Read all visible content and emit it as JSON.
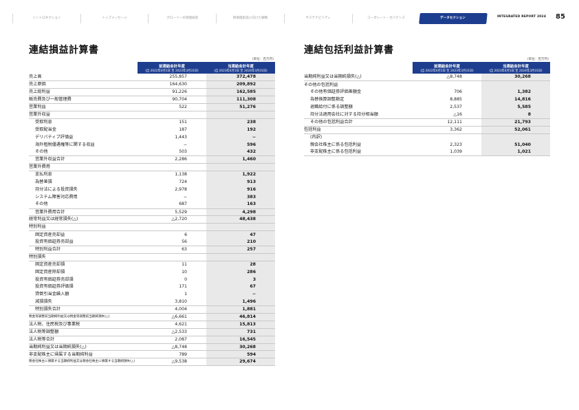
{
  "nav": {
    "items": [
      {
        "label": "イントロダクション",
        "active": false
      },
      {
        "label": "トップメッセージ",
        "active": false
      },
      {
        "label": "グローリーの価値創造",
        "active": false
      },
      {
        "label": "新価値創造に向けた戦略",
        "active": false
      },
      {
        "label": "サステナビリティ",
        "active": false
      },
      {
        "label": "コーポレート・ガバナンス",
        "active": false
      },
      {
        "label": "データセクション",
        "active": true
      }
    ],
    "report": "INTEGRATED REPORT 2024",
    "page": "85"
  },
  "pl": {
    "title": "連結損益計算書",
    "unit": "(単位：百万円)",
    "col_prev": "前連結会計年度",
    "col_prev_sub": "(自 2022年4月1日 至 2023年3月31日)",
    "col_cur": "当連結会計年度",
    "col_cur_sub": "(自 2023年4月1日 至 2024年3月31日)",
    "rows": [
      {
        "label": "売上高",
        "prev": "255,857",
        "cur": "372,478",
        "indent": 0
      },
      {
        "label": "売上原価",
        "prev": "164,630",
        "cur": "209,892",
        "indent": 0
      },
      {
        "label": "売上総利益",
        "prev": "91,226",
        "cur": "162,585",
        "indent": 0
      },
      {
        "label": "販売費及び一般管理費",
        "prev": "90,704",
        "cur": "111,308",
        "indent": 0
      },
      {
        "label": "営業利益",
        "prev": "522",
        "cur": "51,276",
        "indent": 0
      },
      {
        "label": "営業外収益",
        "prev": "",
        "cur": "",
        "indent": 0
      },
      {
        "label": "受取利息",
        "prev": "151",
        "cur": "238",
        "indent": 1,
        "sub": true
      },
      {
        "label": "受取配当金",
        "prev": "187",
        "cur": "192",
        "indent": 1,
        "sub": true
      },
      {
        "label": "デリバティブ評価益",
        "prev": "1,443",
        "cur": "−",
        "indent": 1,
        "sub": true
      },
      {
        "label": "海外租税優遇権等に関する収益",
        "prev": "−",
        "cur": "596",
        "indent": 1,
        "sub": true
      },
      {
        "label": "その他",
        "prev": "503",
        "cur": "432",
        "indent": 1,
        "sub": true,
        "last": true
      },
      {
        "label": "営業外収益合計",
        "prev": "2,286",
        "cur": "1,460",
        "indent": 1
      },
      {
        "label": "営業外費用",
        "prev": "",
        "cur": "",
        "indent": 0
      },
      {
        "label": "支払利息",
        "prev": "1,138",
        "cur": "1,922",
        "indent": 1,
        "sub": true
      },
      {
        "label": "為替差損",
        "prev": "724",
        "cur": "913",
        "indent": 1,
        "sub": true
      },
      {
        "label": "持分法による投資損失",
        "prev": "2,978",
        "cur": "916",
        "indent": 1,
        "sub": true
      },
      {
        "label": "システム障害対応費用",
        "prev": "−",
        "cur": "383",
        "indent": 1,
        "sub": true
      },
      {
        "label": "その他",
        "prev": "687",
        "cur": "163",
        "indent": 1,
        "sub": true,
        "last": true
      },
      {
        "label": "営業外費用合計",
        "prev": "5,529",
        "cur": "4,298",
        "indent": 1
      },
      {
        "label": "経常利益又は経常損失(△)",
        "prev": "△2,720",
        "cur": "48,438",
        "indent": 0
      },
      {
        "label": "特別利益",
        "prev": "",
        "cur": "",
        "indent": 0
      },
      {
        "label": "固定資産売却益",
        "prev": "6",
        "cur": "47",
        "indent": 1,
        "sub": true
      },
      {
        "label": "投資有価証券売却益",
        "prev": "56",
        "cur": "210",
        "indent": 1,
        "sub": true,
        "last": true
      },
      {
        "label": "特別利益合計",
        "prev": "63",
        "cur": "257",
        "indent": 1
      },
      {
        "label": "特別損失",
        "prev": "",
        "cur": "",
        "indent": 0
      },
      {
        "label": "固定資産売却損",
        "prev": "11",
        "cur": "28",
        "indent": 1,
        "sub": true
      },
      {
        "label": "固定資産除却損",
        "prev": "10",
        "cur": "286",
        "indent": 1,
        "sub": true
      },
      {
        "label": "投資有価証券売却損",
        "prev": "0",
        "cur": "3",
        "indent": 1,
        "sub": true
      },
      {
        "label": "投資有価証券評価損",
        "prev": "171",
        "cur": "67",
        "indent": 1,
        "sub": true
      },
      {
        "label": "貸倒引当金繰入額",
        "prev": "1",
        "cur": "−",
        "indent": 1,
        "sub": true
      },
      {
        "label": "減損損失",
        "prev": "3,810",
        "cur": "1,496",
        "indent": 1,
        "sub": true,
        "last": true
      },
      {
        "label": "特別損失合計",
        "prev": "4,004",
        "cur": "1,881",
        "indent": 1
      },
      {
        "label": "税金等調整前当期純利益又は税金等調整前当期純損失(△)",
        "prev": "△6,661",
        "cur": "46,814",
        "indent": 0,
        "size": "xsmall"
      },
      {
        "label": "法人税、住民税及び事業税",
        "prev": "4,621",
        "cur": "15,813",
        "indent": 0
      },
      {
        "label": "法人税等調整額",
        "prev": "△2,533",
        "cur": "731",
        "indent": 0
      },
      {
        "label": "法人税等合計",
        "prev": "2,087",
        "cur": "16,545",
        "indent": 0
      },
      {
        "label": "当期純利益又は当期純損失(△)",
        "prev": "△8,748",
        "cur": "30,268",
        "indent": 0
      },
      {
        "label": "非支配株主に帰属する当期純利益",
        "prev": "789",
        "cur": "594",
        "indent": 0
      },
      {
        "label": "親会社株主に帰属する当期純利益又は親会社株主に帰属する当期純損失(△)",
        "prev": "△9,538",
        "cur": "29,674",
        "indent": 0,
        "size": "xsmall"
      }
    ]
  },
  "ci": {
    "title": "連結包括利益計算書",
    "unit": "(単位：百万円)",
    "col_prev": "前連結会計年度",
    "col_prev_sub": "(自 2022年4月1日 至 2023年3月31日)",
    "col_cur": "当連結会計年度",
    "col_cur_sub": "(自 2023年4月1日 至 2024年3月31日)",
    "rows": [
      {
        "label": "当期純利益又は当期純損失(△)",
        "prev": "△8,748",
        "cur": "30,268",
        "indent": 0
      },
      {
        "label": "その他の包括利益",
        "prev": "",
        "cur": "",
        "indent": 0,
        "sub": true
      },
      {
        "label": "その他有価証券評価差額金",
        "prev": "706",
        "cur": "1,382",
        "indent": 1,
        "sub": true
      },
      {
        "label": "為替換算調整勘定",
        "prev": "8,885",
        "cur": "14,816",
        "indent": 1,
        "sub": true
      },
      {
        "label": "退職給付に係る調整額",
        "prev": "2,537",
        "cur": "5,585",
        "indent": 1,
        "sub": true
      },
      {
        "label": "持分法適用会社に対する持分相当額",
        "prev": "△16",
        "cur": "8",
        "indent": 1,
        "sub": true,
        "last": true
      },
      {
        "label": "その他の包括利益合計",
        "prev": "12,111",
        "cur": "21,793",
        "indent": 1
      },
      {
        "label": "包括利益",
        "prev": "3,362",
        "cur": "52,061",
        "indent": 0
      },
      {
        "label": "(内訳)",
        "prev": "",
        "cur": "",
        "indent": 1,
        "sub": true
      },
      {
        "label": "親会社株主に係る包括利益",
        "prev": "2,323",
        "cur": "51,040",
        "indent": 1,
        "sub": true
      },
      {
        "label": "非支配株主に係る包括利益",
        "prev": "1,039",
        "cur": "1,021",
        "indent": 1,
        "sub": true,
        "last": true
      }
    ]
  }
}
